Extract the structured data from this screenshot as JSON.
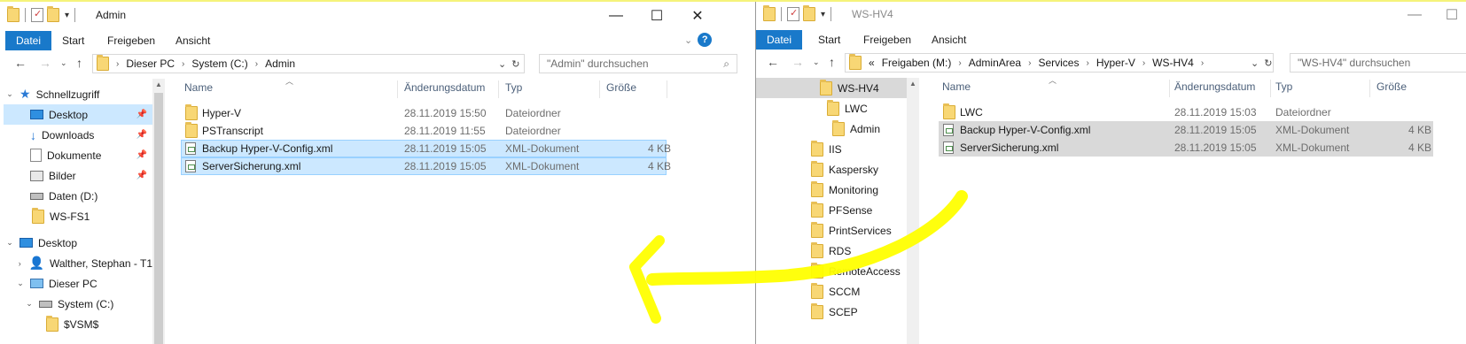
{
  "left_window": {
    "title": "Admin",
    "ribbon_tabs": [
      "Datei",
      "Start",
      "Freigeben",
      "Ansicht"
    ],
    "breadcrumb": [
      "Dieser PC",
      "System (C:)",
      "Admin"
    ],
    "search_placeholder": "\"Admin\" durchsuchen",
    "columns": [
      "Name",
      "Änderungsdatum",
      "Typ",
      "Größe"
    ],
    "nav_items": [
      {
        "label": "Schnellzugriff",
        "icon": "star-icon"
      },
      {
        "label": "Desktop",
        "icon": "desktop-icon"
      },
      {
        "label": "Downloads",
        "icon": "download-icon"
      },
      {
        "label": "Dokumente",
        "icon": "document-icon"
      },
      {
        "label": "Bilder",
        "icon": "pictures-icon"
      },
      {
        "label": "Daten (D:)",
        "icon": "drive-icon"
      },
      {
        "label": "WS-FS1",
        "icon": "folder-icon"
      },
      {
        "label": "Desktop",
        "icon": "desktop-icon"
      },
      {
        "label": "Walther, Stephan - T1",
        "icon": "user-icon"
      },
      {
        "label": "Dieser PC",
        "icon": "pc-icon"
      },
      {
        "label": "System (C:)",
        "icon": "drive-icon"
      },
      {
        "label": "$VSM$",
        "icon": "folder-icon"
      }
    ],
    "files": [
      {
        "name": "Hyper-V",
        "date": "28.11.2019 15:50",
        "type": "Dateiordner",
        "size": ""
      },
      {
        "name": "PSTranscript",
        "date": "28.11.2019 11:55",
        "type": "Dateiordner",
        "size": ""
      },
      {
        "name": "Backup Hyper-V-Config.xml",
        "date": "28.11.2019 15:05",
        "type": "XML-Dokument",
        "size": "4 KB"
      },
      {
        "name": "ServerSicherung.xml",
        "date": "28.11.2019 15:05",
        "type": "XML-Dokument",
        "size": "4 KB"
      }
    ]
  },
  "right_window": {
    "title": "WS-HV4",
    "ribbon_tabs": [
      "Datei",
      "Start",
      "Freigeben",
      "Ansicht"
    ],
    "breadcrumb": [
      "«",
      "Freigaben (M:)",
      "AdminArea",
      "Services",
      "Hyper-V",
      "WS-HV4"
    ],
    "search_placeholder": "\"WS-HV4\" durchsuchen",
    "columns": [
      "Name",
      "Änderungsdatum",
      "Typ",
      "Größe"
    ],
    "nav_items": [
      {
        "label": "WS-HV4",
        "icon": "folder-icon"
      },
      {
        "label": "LWC",
        "icon": "folder-icon"
      },
      {
        "label": "Admin",
        "icon": "folder-icon"
      },
      {
        "label": "IIS",
        "icon": "folder-icon"
      },
      {
        "label": "Kaspersky",
        "icon": "folder-icon"
      },
      {
        "label": "Monitoring",
        "icon": "folder-icon"
      },
      {
        "label": "PFSense",
        "icon": "folder-icon"
      },
      {
        "label": "PrintServices",
        "icon": "folder-icon"
      },
      {
        "label": "RDS",
        "icon": "folder-icon"
      },
      {
        "label": "RemoteAccess",
        "icon": "folder-icon"
      },
      {
        "label": "SCCM",
        "icon": "folder-icon"
      },
      {
        "label": "SCEP",
        "icon": "folder-icon"
      }
    ],
    "files": [
      {
        "name": "LWC",
        "date": "28.11.2019 15:03",
        "type": "Dateiordner",
        "size": ""
      },
      {
        "name": "Backup Hyper-V-Config.xml",
        "date": "28.11.2019 15:05",
        "type": "XML-Dokument",
        "size": "4 KB"
      },
      {
        "name": "ServerSicherung.xml",
        "date": "28.11.2019 15:05",
        "type": "XML-Dokument",
        "size": "4 KB"
      }
    ]
  },
  "colors": {
    "accent": "#1979ca",
    "selection": "#cce8ff",
    "annotation_arrow": "#ffff00"
  }
}
